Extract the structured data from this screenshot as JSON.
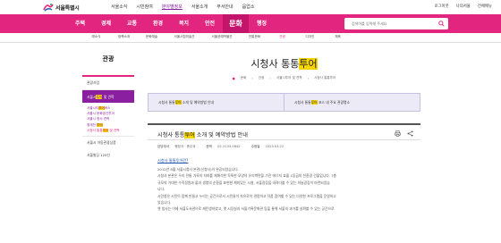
{
  "header": {
    "logo_text": "서울특별시",
    "utility_nav": [
      "서울소식",
      "시민참여",
      "분야별정보",
      "서울소개",
      "부서안내",
      "읍업소"
    ],
    "utility_active_index": 2,
    "utility_right": [
      "로그아웃",
      "나의서울",
      "전체메뉴"
    ]
  },
  "main_nav": {
    "items": [
      "주택",
      "경제",
      "교통",
      "환경",
      "복지",
      "안전",
      "문화",
      "행정"
    ],
    "active_index": 6,
    "search_placeholder": "검색어를 입력해 주세요"
  },
  "sub_nav": {
    "items": [
      "예소식",
      "정책소개",
      "문화예술",
      "서울시립미술관",
      "서울공예박물관",
      "전통문화",
      "관광",
      "디자인",
      "체육"
    ]
  },
  "sidebar": {
    "title": "관광",
    "items": [
      {
        "label": "관광사업"
      },
      {
        "label_before": "서울시",
        "label_highlight": "투어",
        "label_after": " 및 견학",
        "active": true
      }
    ],
    "sub_items": [
      {
        "before": "서울시티",
        "highlight": "투어",
        "after": "버스"
      },
      {
        "before": "서울시 문화공간",
        "highlight": "",
        "after": "투어"
      },
      {
        "before": "서울시 청사 견학",
        "highlight": "",
        "after": ""
      },
      {
        "before": "청계천 ",
        "highlight": "투어",
        "after": ""
      },
      {
        "before": "시청사 통통",
        "highlight": "투어",
        "after": " 및 견학"
      }
    ],
    "bottom_items": [
      "서울시 아동관광상품",
      "서울빌딩 120선"
    ]
  },
  "content": {
    "title_before": "시청사 통통",
    "title_highlight": "투어",
    "breadcrumb": [
      "문화",
      "관광",
      "서울시투어 및 견학",
      "시청사 통통투어"
    ],
    "tabs": [
      {
        "before": "시청사 통통",
        "highlight": "투어",
        "after": " 소개 및 예약방법 안내"
      },
      {
        "before": "시청사 통통",
        "highlight": "투어",
        "after": " 코스 내 주요 관광명소"
      }
    ],
    "article_title_before": "시청사 통통",
    "article_title_highlight": "투어",
    "article_title_after": " 소개 및 예약방법 안내",
    "meta": {
      "dept_label": "담당부서",
      "dept_value": "행정국 · 총무과",
      "phone_label": "문의",
      "phone_value": "02-2133-5842",
      "date_label": "수정일",
      "date_value": "2023.03.22"
    },
    "section_title": "시청사 통통투어란?",
    "paragraphs": [
      "2012년 8월 서울시청사 본관(신청사)이 완공되었습니다.",
      "시청사 본관은 우리 전통 가옥의 처마를 재해석한 독특한 모양의 유리벽면을 가진 에너지 효율 1등급의 친환경 건물입니다. 7층",
      "규모의 거대한 수직정원과 물과 생명의 순환을 표현한 재미있는 시설, 서울광장을 내려다볼 수 있는 하늘광장이 마련되었습",
      "니다.",
      "시민청은 시민이 함께 만들고 누리는 공간으로서 시민들이 자유로이 관람하고 작품 참여할 수 있는 다양한 프로그램을 운영하고",
      "있습니다.",
      "옛 청사는 이제 서울도서관으로 재탄생하였고, 옛 시장실과 서울기록문화관 등을 통해 서울의 과거를 살펴볼 수 있는 공간으로"
    ]
  },
  "colors": {
    "brand_pink": "#e2257e",
    "active_purple": "#8a1fa0",
    "highlight_yellow": "#f5d400",
    "link_blue": "#1b4ea8"
  }
}
